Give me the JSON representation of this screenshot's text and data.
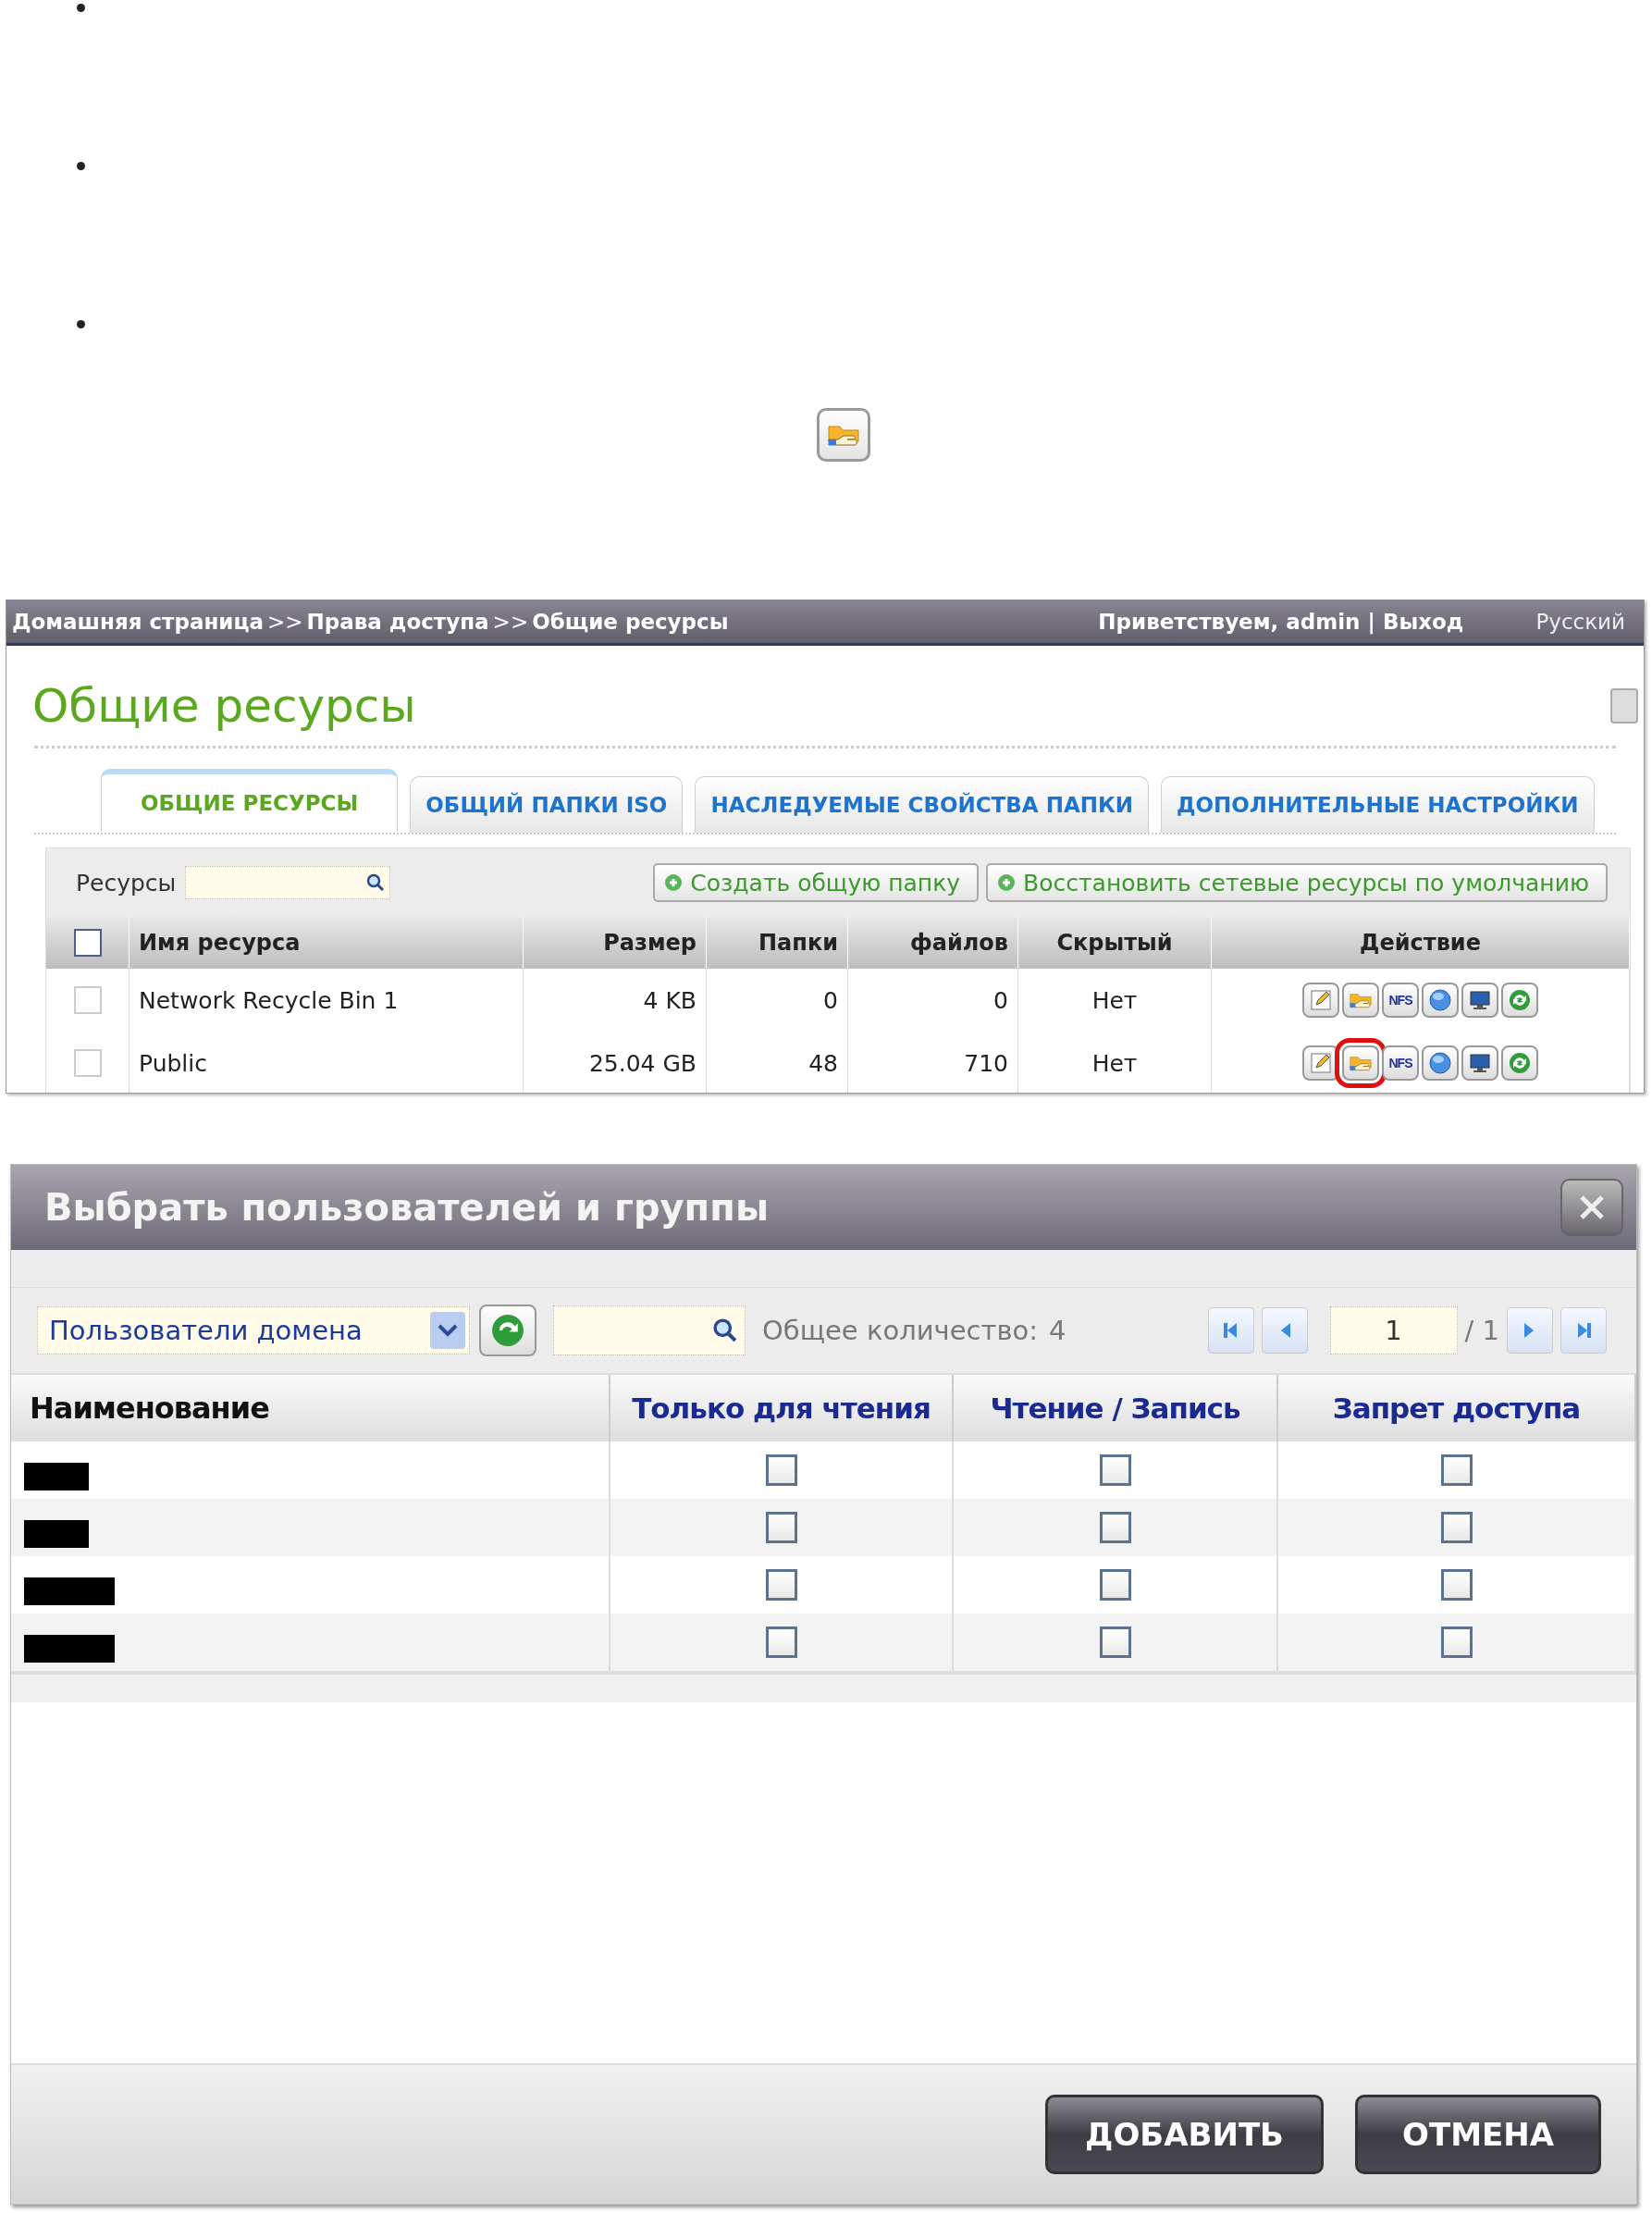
{
  "intro": {
    "bullets": [
      {
        "kind": "bullet"
      },
      {
        "kind": "bullet"
      },
      {
        "kind": "bullet"
      }
    ]
  },
  "share_page": {
    "breadcrumb": {
      "items": [
        "Домашняя страница",
        "Права доступа",
        "Общие ресурсы"
      ],
      "separator": ">>"
    },
    "greeting": "Приветствуем,",
    "user": "admin",
    "divider": "|",
    "logout": "Выход",
    "language": "Русский",
    "title": "Общие ресурсы",
    "tabs": [
      {
        "label": "ОБЩИЕ РЕСУРСЫ",
        "selected": true
      },
      {
        "label": "ОБЩИЙ ПАПКИ ISO",
        "selected": false
      },
      {
        "label": "НАСЛЕДУЕМЫЕ СВОЙСТВА ПАПКИ",
        "selected": false
      },
      {
        "label": "ДОПОЛНИТЕЛЬНЫЕ НАСТРОЙКИ",
        "selected": false
      }
    ],
    "search_label": "Ресурсы",
    "buttons": [
      "Создать общую папку",
      "Восстановить сетевые ресурсы по умолчанию"
    ],
    "table": {
      "columns": [
        "Имя ресурса",
        "Размер",
        "Папки",
        "файлов",
        "Скрытый",
        "Действие"
      ],
      "select_all_checked": false,
      "rows": [
        {
          "checked": false,
          "cells": [
            "Network Recycle Bin 1",
            "4 KB",
            "0",
            "0",
            "Нет"
          ],
          "actions": [
            {
              "kind": "edit",
              "highlighted": false
            },
            {
              "kind": "permissions",
              "highlighted": false
            },
            {
              "kind": "nfs",
              "label": "NFS",
              "highlighted": false
            },
            {
              "kind": "globe",
              "highlighted": false
            },
            {
              "kind": "monitor",
              "highlighted": false
            },
            {
              "kind": "refresh",
              "highlighted": false
            }
          ]
        },
        {
          "checked": false,
          "cells": [
            "Public",
            "25.04 GB",
            "48",
            "710",
            "Нет"
          ],
          "actions": [
            {
              "kind": "edit",
              "highlighted": false
            },
            {
              "kind": "permissions",
              "highlighted": true
            },
            {
              "kind": "nfs",
              "label": "NFS",
              "highlighted": false
            },
            {
              "kind": "globe",
              "highlighted": false
            },
            {
              "kind": "monitor",
              "highlighted": false
            },
            {
              "kind": "refresh",
              "highlighted": false
            }
          ]
        }
      ]
    }
  },
  "dialog": {
    "title": "Выбрать пользователей и группы",
    "filter": {
      "value": "Пользователи домена"
    },
    "total_label": "Общее количество:",
    "total": "4",
    "pager": {
      "page": "1",
      "of": "/ 1"
    },
    "columns": [
      "Наименование",
      "Только для чтения",
      "Чтение / Запись",
      "Запрет доступа"
    ],
    "rows": [
      {
        "name": {
          "kind": "redacted"
        },
        "read_only": false,
        "read_write": false,
        "deny": false
      },
      {
        "name": {
          "kind": "redacted"
        },
        "read_only": false,
        "read_write": false,
        "deny": false
      },
      {
        "name": {
          "kind": "redacted"
        },
        "read_only": false,
        "read_write": false,
        "deny": false
      },
      {
        "name": {
          "kind": "redacted"
        },
        "read_only": false,
        "read_write": false,
        "deny": false
      }
    ],
    "buttons": [
      "ДОБАВИТЬ",
      "ОТМЕНА"
    ]
  }
}
